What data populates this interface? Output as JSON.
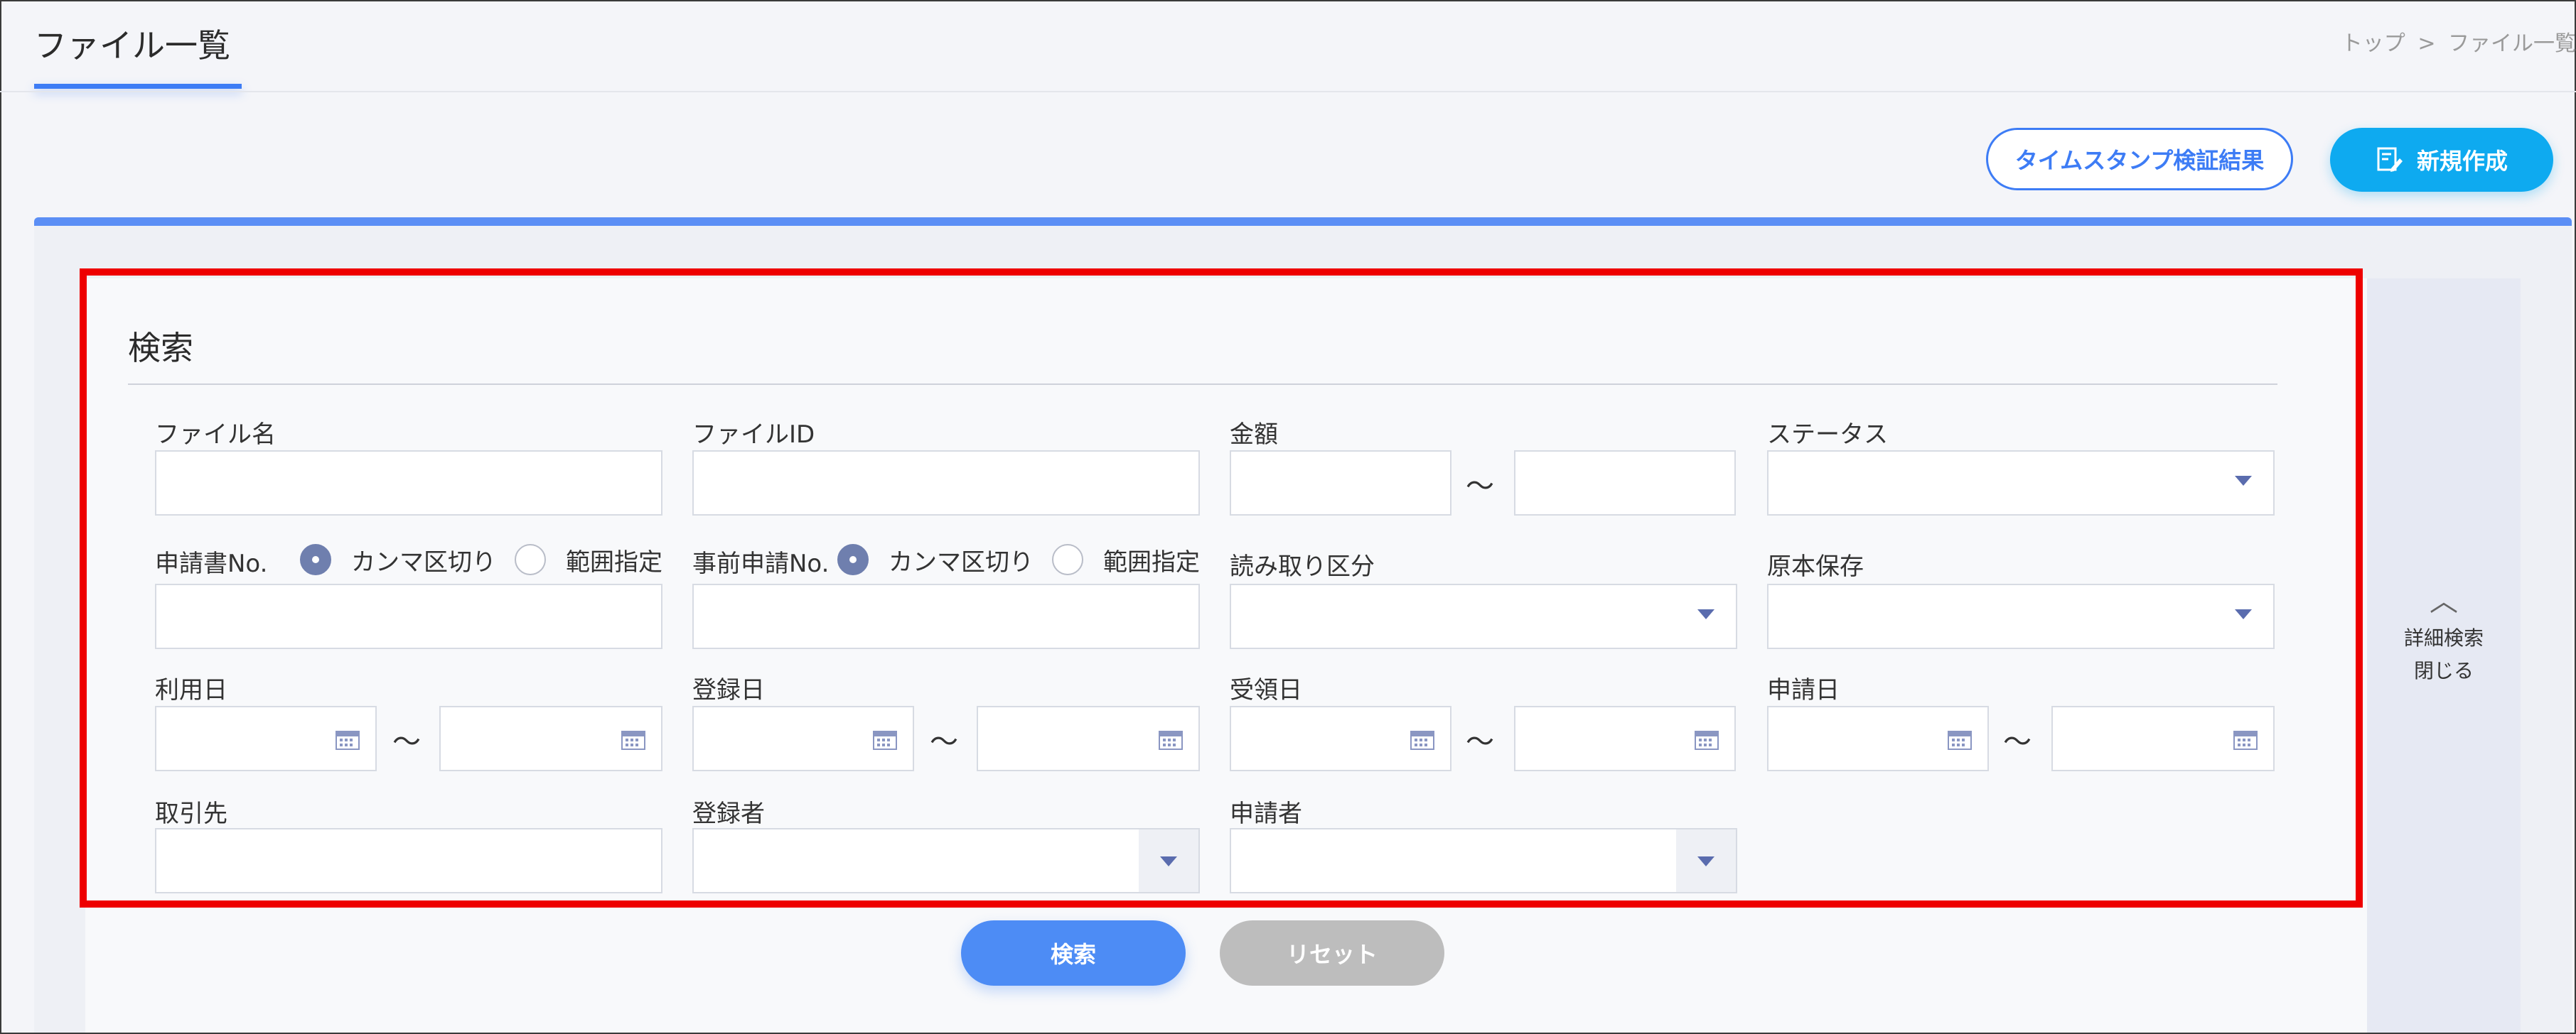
{
  "header": {
    "title": "ファイル一覧",
    "breadcrumb": [
      "トップ",
      ">",
      "ファイル一覧"
    ]
  },
  "toolbar": {
    "timestamp_label": "タイムスタンプ検証結果",
    "new_label": "新規作成"
  },
  "search": {
    "heading": "検索",
    "file_name_label": "ファイル名",
    "file_id_label": "ファイルID",
    "amount_label": "金額",
    "status_label": "ステータス",
    "application_no_label": "申請書No.",
    "pre_application_no_label": "事前申請No.",
    "comma_label": "カンマ区切り",
    "range_label": "範囲指定",
    "read_category_label": "読み取り区分",
    "original_storage_label": "原本保存",
    "usage_date_label": "利用日",
    "register_date_label": "登録日",
    "receipt_date_label": "受領日",
    "application_date_label": "申請日",
    "client_label": "取引先",
    "registrant_label": "登録者",
    "applicant_label": "申請者",
    "tilde": "～",
    "search_button": "検索",
    "reset_button": "リセット"
  },
  "side_panel": {
    "line1": "詳細検索",
    "line2": "閉じる"
  },
  "colors": {
    "accent": "#3d7cf5",
    "primary_button": "#0eaaf0",
    "highlight_box": "#ee0000",
    "radio_selected": "#6f7fae"
  }
}
